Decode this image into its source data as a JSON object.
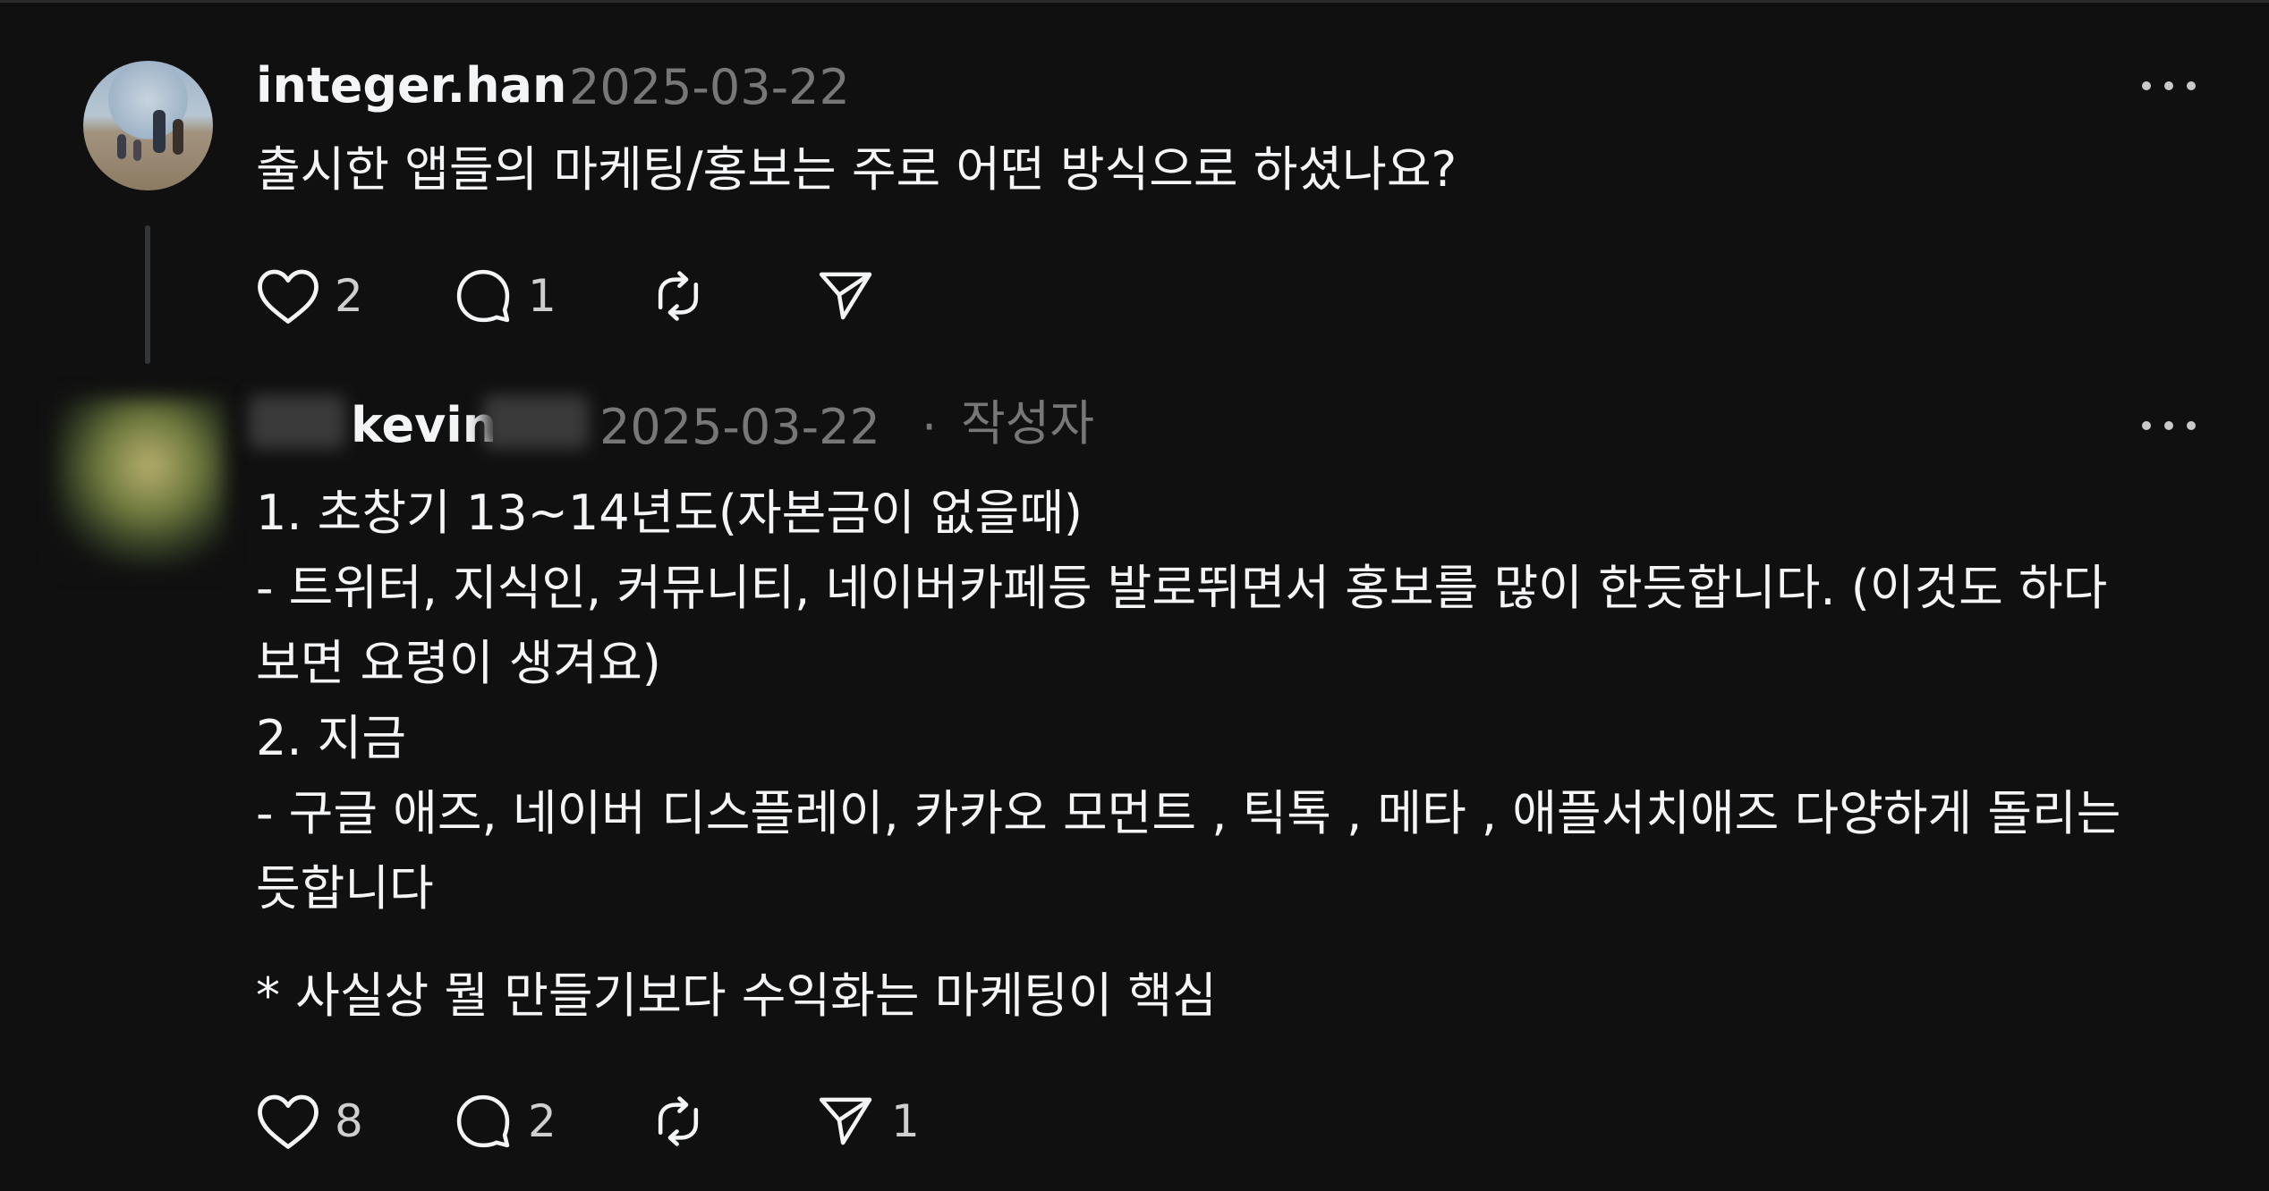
{
  "post": {
    "username": "integer.han",
    "date": "2025-03-22",
    "text": "출시한 앱들의 마케팅/홍보는 주로 어떤 방식으로 하셨나요?",
    "actions": {
      "likes": "2",
      "replies": "1",
      "reposts": "",
      "shares": ""
    },
    "icons": {
      "avatar": "beach-family-avatar",
      "like": "heart-icon",
      "reply": "speech-bubble-icon",
      "repost": "repost-icon",
      "share": "paper-plane-icon",
      "more": "more-dots-icon"
    }
  },
  "reply": {
    "username": "kevin",
    "date": "2025-03-22",
    "separator": "·",
    "author_tag": "작성자",
    "lines": [
      "1. 초창기 13~14년도(자본금이 없을때)",
      "- 트위터, 지식인, 커뮤니티, 네이버카페등 발로뛰면서 홍보를 많이 한듯합니다. (이것도 하다",
      "보면 요령이 생겨요)",
      "2. 지금",
      "- 구글 애즈, 네이버 디스플레이, 카카오 모먼트 , 틱톡 , 메타 , 애플서치애즈 다양하게 돌리는",
      "듯합니다",
      "* 사실상 뭘 만들기보다 수익화는 마케팅이 핵심"
    ],
    "actions": {
      "likes": "8",
      "replies": "2",
      "reposts": "",
      "shares": "1"
    }
  },
  "colors": {
    "background": "#101010",
    "text": "#f3f5f7",
    "muted": "#777777"
  }
}
